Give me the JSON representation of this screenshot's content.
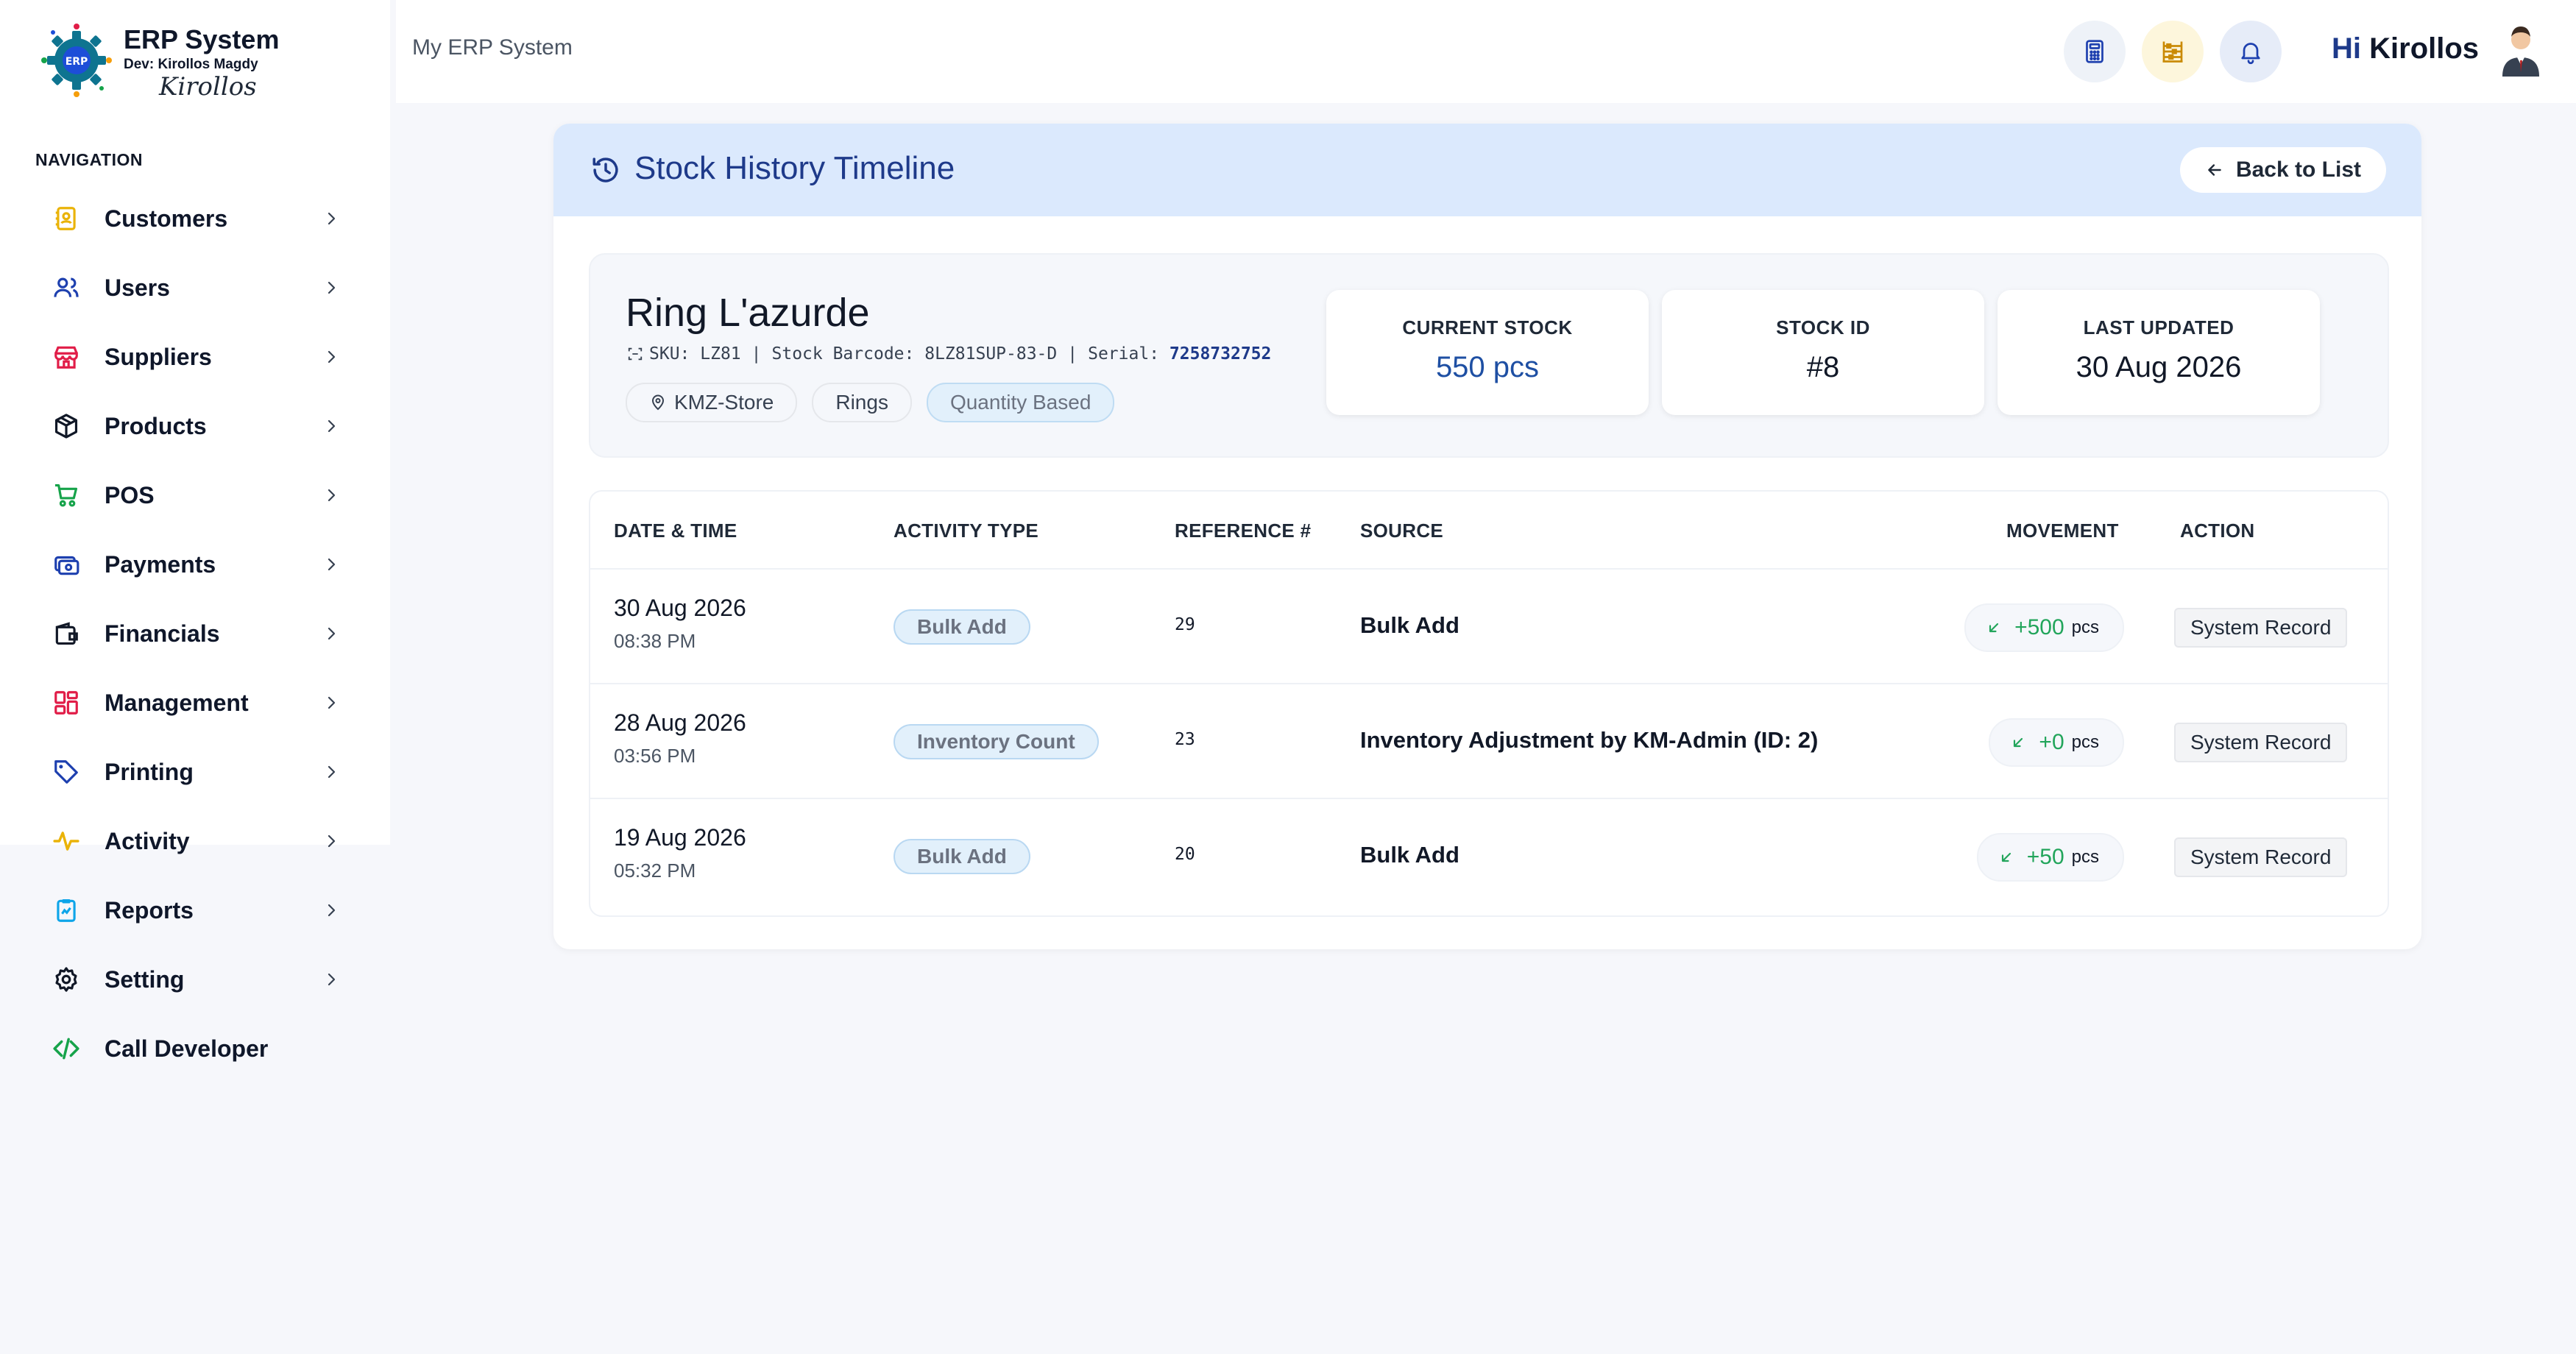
{
  "brand": {
    "title": "ERP System",
    "dev": "Dev: Kirollos Magdy",
    "signature": "Kirollos",
    "logo_text": "ERP"
  },
  "sidebar": {
    "heading": "NAVIGATION",
    "items": [
      {
        "label": "Customers",
        "icon": "contacts-icon",
        "color": "#eab308"
      },
      {
        "label": "Users",
        "icon": "users-icon",
        "color": "#1e40af"
      },
      {
        "label": "Suppliers",
        "icon": "store-icon",
        "color": "#e11d48"
      },
      {
        "label": "Products",
        "icon": "box-icon",
        "color": "#111827"
      },
      {
        "label": "POS",
        "icon": "cart-icon",
        "color": "#16a34a"
      },
      {
        "label": "Payments",
        "icon": "payment-icon",
        "color": "#1e40af"
      },
      {
        "label": "Financials",
        "icon": "wallet-icon",
        "color": "#111827"
      },
      {
        "label": "Management",
        "icon": "dashboard-icon",
        "color": "#e11d48"
      },
      {
        "label": "Printing",
        "icon": "tag-icon",
        "color": "#1e40af"
      },
      {
        "label": "Activity",
        "icon": "pulse-icon",
        "color": "#eab308"
      },
      {
        "label": "Reports",
        "icon": "clipboard-icon",
        "color": "#0ea5e9"
      },
      {
        "label": "Setting",
        "icon": "gear-icon",
        "color": "#111827"
      },
      {
        "label": "Call Developer",
        "icon": "code-icon",
        "color": "#16a34a"
      }
    ]
  },
  "topbar": {
    "breadcrumb": "My ERP System",
    "greeting_hi": "Hi",
    "user_name": "Kirollos",
    "buttons": [
      {
        "icon": "calculator-icon",
        "bg": "#eef2f8",
        "color": "#1e40af"
      },
      {
        "icon": "abacus-icon",
        "bg": "#fdf6dc",
        "color": "#ca8a04"
      },
      {
        "icon": "bell-icon",
        "bg": "#e6ecf8",
        "color": "#1e40af"
      }
    ]
  },
  "page": {
    "title": "Stock History Timeline",
    "back_label": "Back to List"
  },
  "product": {
    "name": "Ring L'azurde",
    "sku_label": "SKU:",
    "sku": "LZ81",
    "barcode_label": "Stock Barcode:",
    "barcode": "8LZ81SUP-83-D",
    "serial_label": "Serial:",
    "serial": "7258732752",
    "tags": [
      "KMZ-Store",
      "Rings",
      "Quantity Based"
    ]
  },
  "stats": [
    {
      "label": "CURRENT STOCK",
      "value": "550 pcs"
    },
    {
      "label": "STOCK ID",
      "value": "#8"
    },
    {
      "label": "LAST UPDATED",
      "value": "30 Aug 2026"
    }
  ],
  "table": {
    "headers": [
      "DATE & TIME",
      "ACTIVITY TYPE",
      "REFERENCE #",
      "SOURCE",
      "MOVEMENT",
      "ACTION"
    ],
    "rows": [
      {
        "date": "30 Aug 2026",
        "time": "08:38 PM",
        "type": "Bulk Add",
        "ref": "29",
        "source": "Bulk Add",
        "movement": "+500",
        "unit": "pcs",
        "action": "System Record"
      },
      {
        "date": "28 Aug 2026",
        "time": "03:56 PM",
        "type": "Inventory Count",
        "ref": "23",
        "source": "Inventory Adjustment by KM-Admin (ID: 2)",
        "movement": "+0",
        "unit": "pcs",
        "action": "System Record"
      },
      {
        "date": "19 Aug 2026",
        "time": "05:32 PM",
        "type": "Bulk Add",
        "ref": "20",
        "source": "Bulk Add",
        "movement": "+50",
        "unit": "pcs",
        "action": "System Record"
      }
    ]
  }
}
